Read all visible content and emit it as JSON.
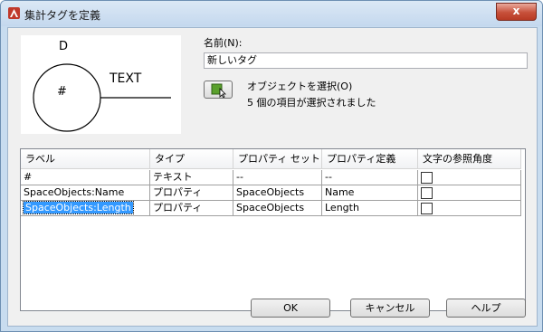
{
  "window": {
    "title": "集計タグを定義",
    "close_glyph": "x"
  },
  "preview": {
    "top_letter": "D",
    "center_symbol": "#",
    "side_label": "TEXT"
  },
  "form": {
    "name_label": "名前(N):",
    "name_value": "新しいタグ",
    "select_objects_label": "オブジェクトを選択(O)",
    "selected_count_text": "5 個の項目が選択されました"
  },
  "grid": {
    "columns": [
      "ラベル",
      "タイプ",
      "プロパティ セット",
      "プロパティ定義",
      "文字の参照角度"
    ],
    "rows": [
      {
        "label": "#",
        "type": "テキスト",
        "property_set": "--",
        "property_def": "--",
        "checked": false
      },
      {
        "label": "SpaceObjects:Name",
        "type": "プロパティ",
        "property_set": "SpaceObjects",
        "property_def": "Name",
        "checked": false
      },
      {
        "label": "SpaceObjects:Length",
        "type": "プロパティ",
        "property_set": "SpaceObjects",
        "property_def": "Length",
        "checked": false,
        "selected": true
      }
    ]
  },
  "buttons": {
    "ok": "OK",
    "cancel": "キャンセル",
    "help": "ヘルプ"
  },
  "colors": {
    "selection": "#3399ff",
    "select_button_icon": "#5aa02c"
  }
}
